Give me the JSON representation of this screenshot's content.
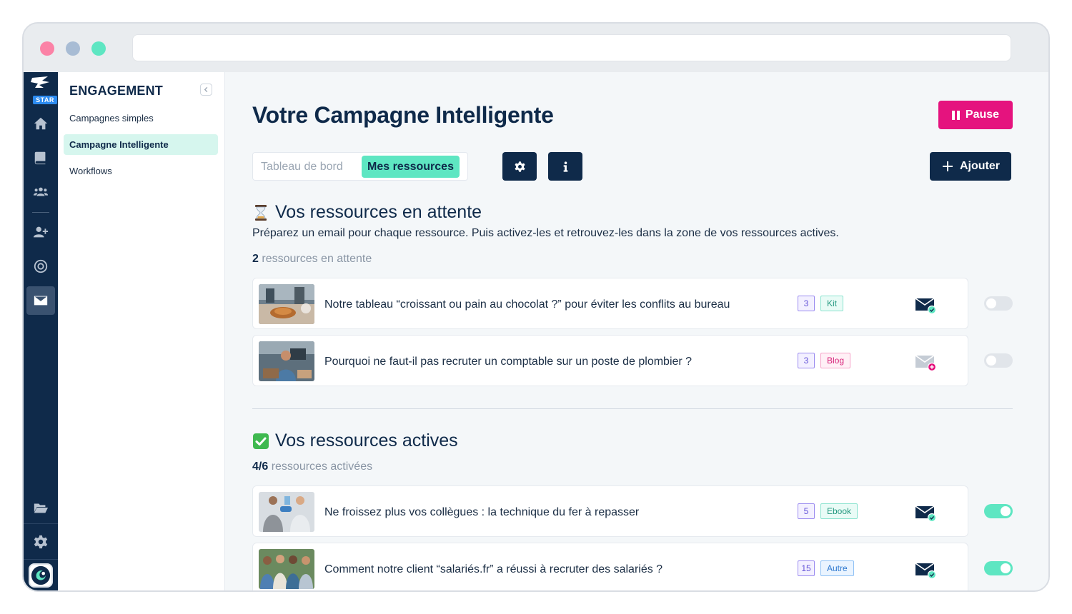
{
  "rail": {
    "logo_badge": "STAR",
    "items": [
      {
        "icon": "home-icon"
      },
      {
        "icon": "book-icon"
      },
      {
        "icon": "users-icon"
      },
      {
        "icon": "user-plus-icon"
      },
      {
        "icon": "target-icon"
      },
      {
        "icon": "envelope-icon",
        "active": true
      },
      {
        "icon": "folder-open-icon"
      },
      {
        "icon": "gear-icon"
      }
    ]
  },
  "subnav": {
    "title": "ENGAGEMENT",
    "items": [
      {
        "label": "Campagnes simples"
      },
      {
        "label": "Campagne Intelligente",
        "active": true
      },
      {
        "label": "Workflows"
      }
    ]
  },
  "header": {
    "title": "Votre Campagne Intelligente",
    "pause_label": "Pause",
    "tabs": [
      {
        "label": "Tableau de bord"
      },
      {
        "label": "Mes ressources",
        "active": true
      }
    ],
    "add_label": "Ajouter"
  },
  "pending": {
    "title": "Vos ressources en attente",
    "description": "Préparez un email pour chaque ressource. Puis activez-les et retrouvez-les dans la zone de vos ressources actives.",
    "count": "2",
    "count_suffix": "ressources en attente",
    "items": [
      {
        "title": "Notre tableau “croissant ou pain au chocolat ?” pour éviter les conflits au bureau",
        "count": "3",
        "type": "Kit",
        "email": "ready",
        "enabled": false
      },
      {
        "title": "Pourquoi ne faut-il pas recruter un comptable sur un poste de plombier ?",
        "count": "3",
        "type": "Blog",
        "email": "missing",
        "enabled": false
      }
    ]
  },
  "active": {
    "title": "Vos ressources actives",
    "count": "4/6",
    "count_suffix": "ressources activées",
    "items": [
      {
        "title": "Ne froissez plus vos collègues : la technique du fer à repasser",
        "count": "5",
        "type": "Ebook",
        "email": "ready",
        "enabled": true
      },
      {
        "title": "Comment notre client “salariés.fr” a réussi à recruter des salariés ?",
        "count": "15",
        "type": "Autre",
        "email": "ready",
        "enabled": true
      }
    ]
  },
  "colors": {
    "navy": "#0f2a4a",
    "accent_mint": "#5ee6c2",
    "pause_pink": "#e5137e",
    "toggle_off": "#e1e5ea"
  }
}
